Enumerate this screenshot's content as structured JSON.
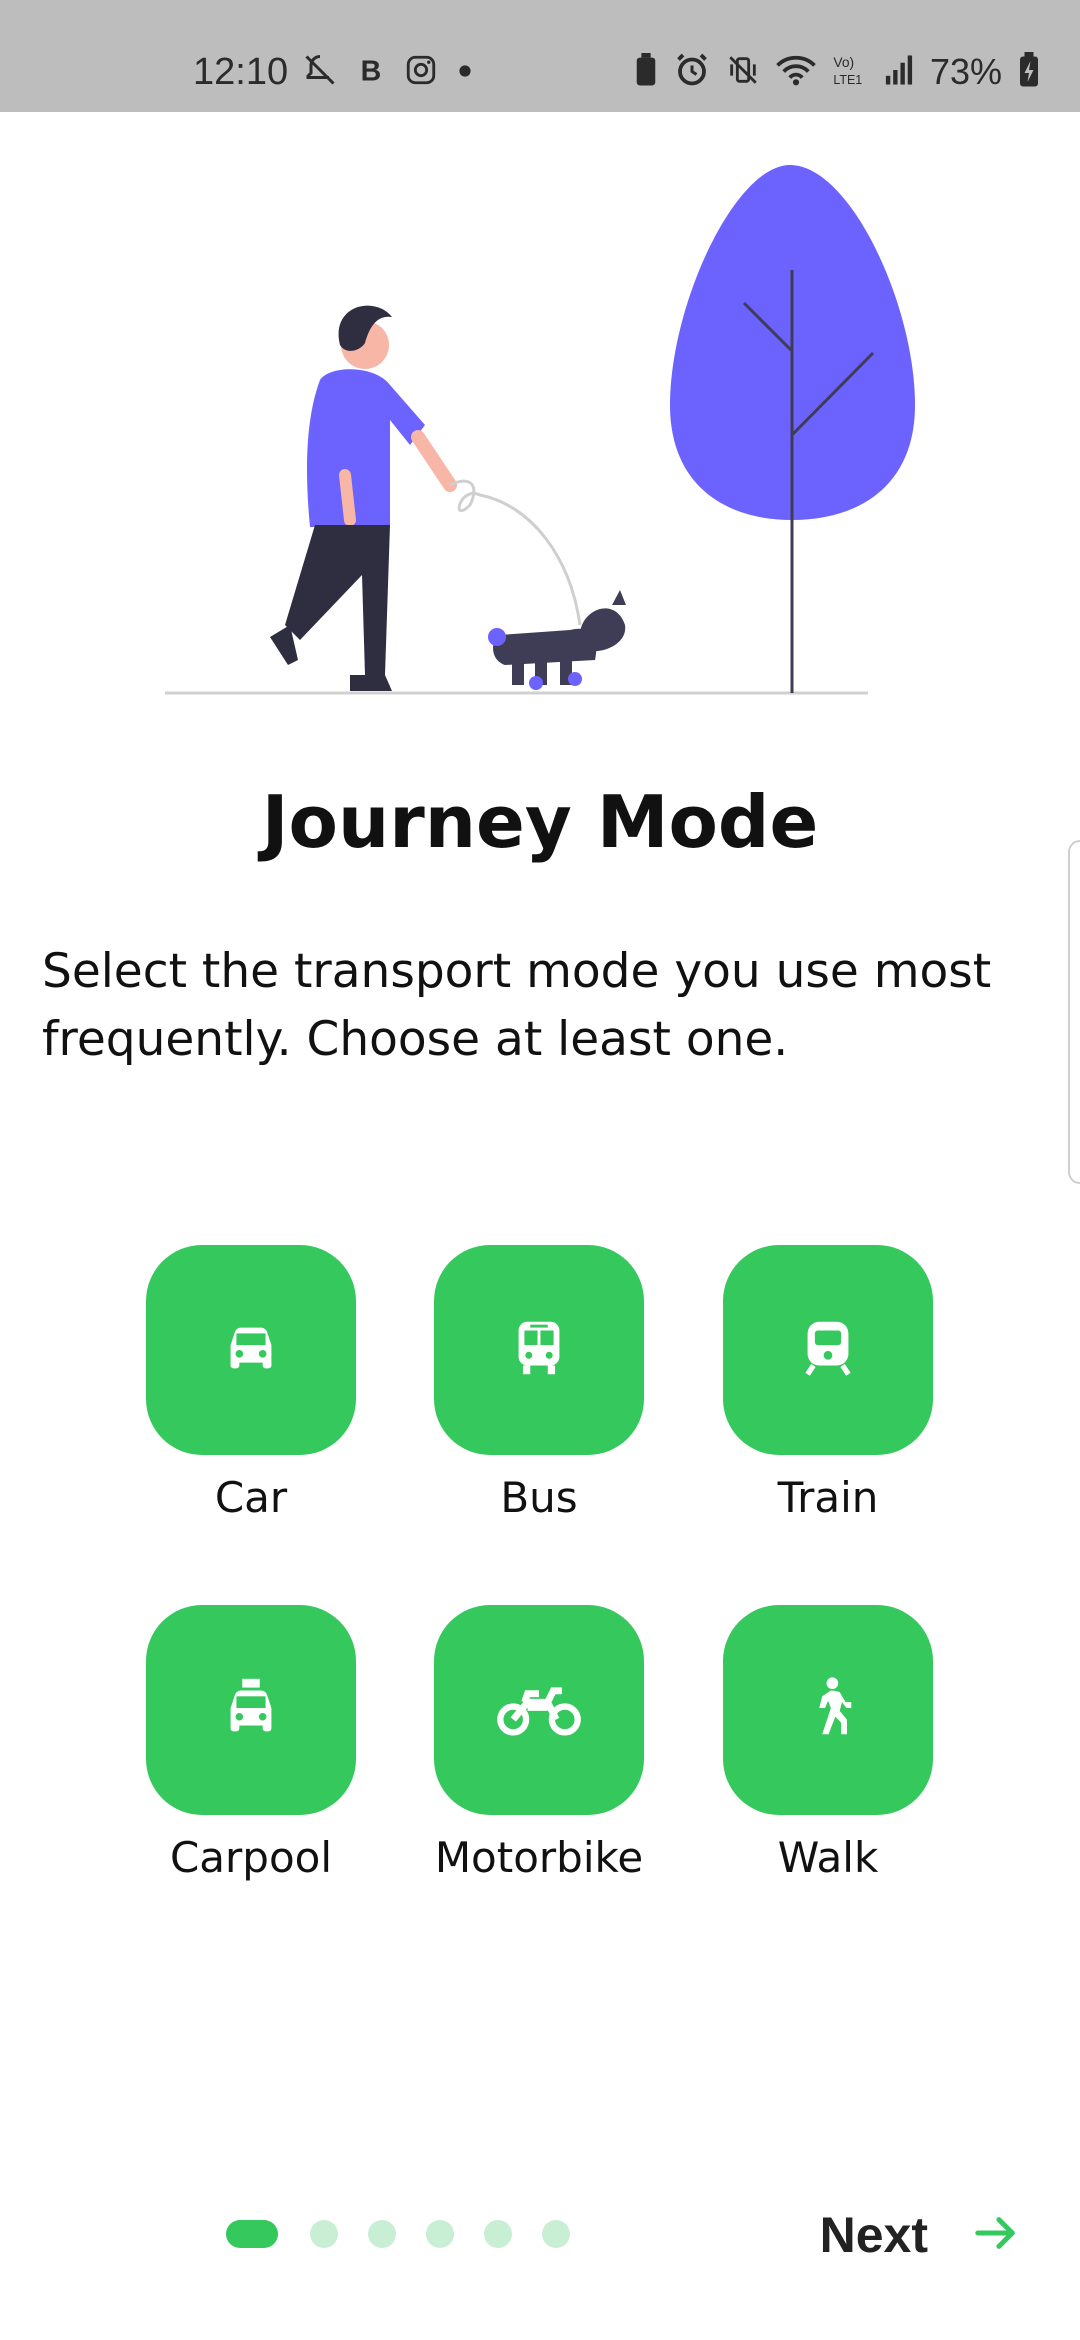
{
  "status_bar": {
    "time": "12:10",
    "battery_percent": "73%",
    "icons_left": [
      "notifications-off-icon",
      "b-app-icon",
      "instagram-icon",
      "dot-icon"
    ],
    "icons_right": [
      "battery-saver-icon",
      "alarm-icon",
      "vibrate-icon",
      "wifi-icon",
      "volte-icon",
      "signal-icon",
      "battery-charging-icon"
    ]
  },
  "illustration": {
    "description_icon": "person-walking-dog-illustration"
  },
  "header": {
    "title": "Journey Mode",
    "subtitle": "Select the transport mode you use most frequently. Choose at least one."
  },
  "modes": [
    {
      "label": "Car",
      "icon": "car-icon"
    },
    {
      "label": "Bus",
      "icon": "bus-icon"
    },
    {
      "label": "Train",
      "icon": "train-icon"
    },
    {
      "label": "Carpool",
      "icon": "taxi-icon"
    },
    {
      "label": "Motorbike",
      "icon": "motorbike-icon"
    },
    {
      "label": "Walk",
      "icon": "walk-icon"
    }
  ],
  "pager": {
    "total_pages": 6,
    "current_page": 1
  },
  "footer": {
    "next_label": "Next"
  },
  "colors": {
    "accent": "#35c85c",
    "accent_light": "#c8eed4",
    "illustration_purple": "#6c63ff",
    "status_bar_bg": "#bdbdbd"
  }
}
